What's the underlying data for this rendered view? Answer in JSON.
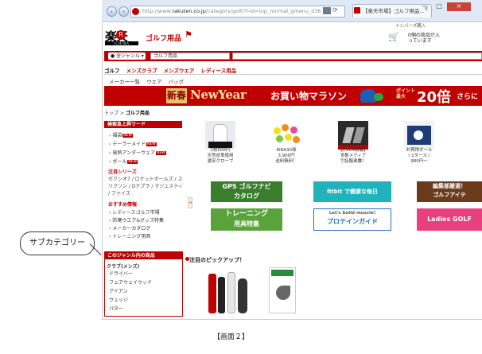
{
  "browser": {
    "back": "‹",
    "forward": "›",
    "url_prefix": "http://www.",
    "url_host": "rakuten.co.jp",
    "url_path": "/category/golf/?l-id=top_normal_gmenu_d36",
    "tab_title": "【楽天市場】ゴルフ用品...",
    "tab_close": "×",
    "minimize": "—",
    "maximize": "□",
    "close": "×"
  },
  "header": {
    "logo_text": "楽天",
    "logo_r": "R",
    "logo_sub": "ICHIBA",
    "genre_title": "ゴルフ用品",
    "topright_link": "ナンバーズ購入",
    "cart_text_line1": "0個の商品が入",
    "cart_text_line2": "っています"
  },
  "search": {
    "all_genre": "● 全ジャンル ▾",
    "genre_value": "ゴルフ用品"
  },
  "category_nav": {
    "items": [
      "ゴルフ",
      "メンズクラブ",
      "メンズウエア",
      "レディース用品"
    ]
  },
  "sub_nav": {
    "items": [
      "メーカー一覧",
      "ウエア",
      "バッグ"
    ]
  },
  "banner": {
    "new_kanji": "新春",
    "new_year": "NewYear",
    "marathon": "お買い物マラソン",
    "point_line1": "ポイント",
    "point_line2": "最大",
    "multiplier": "20倍",
    "more": "さらに"
  },
  "breadcrumb": {
    "top": "トップ >",
    "current": "ゴルフ用品"
  },
  "sidebar": {
    "rising_title": "検索急上昇ワード",
    "rising_items": [
      {
        "label": "福袋",
        "new": "NEW"
      },
      {
        "label": "テーラーメイド",
        "new": "NEW"
      },
      {
        "label": "発熱アンダーウェア",
        "new": "NEW"
      },
      {
        "label": "ボール",
        "new": "NEW"
      }
    ],
    "new_label": "NEW",
    "series_title": "注目シリーズ",
    "series_text": "ゼクシオ7 / ロケットボールズ / スリクソン / Dナブラ / マジェスティ / ファイズ",
    "recommend_title": "おすすめ情報",
    "recommend_items": [
      "レディースゴルフ市場",
      "防寒ウエア&グッズ特集",
      "メーカーカタログ",
      "トレーニング用具"
    ],
    "genre_box_title": "このジャンル内の商品",
    "club_label": "クラブ(メンズ)",
    "club_items": [
      "ドライバー",
      "フェアウェイウッド",
      "アイアン",
      "ウェッジ",
      "パター"
    ]
  },
  "products": [
    {
      "caption_line1": "1枚500円",
      "caption_line2": "天然皮革使用",
      "caption_line3": "激安グローブ"
    },
    {
      "caption_line1": "KIRA30球",
      "caption_line2": "3,900円",
      "caption_line3": "送料無料！"
    },
    {
      "caption_line1": "【EVEN掲載】",
      "caption_line2": "多数メディア",
      "caption_line3": "で話題沸騰！"
    },
    {
      "caption_line1": "お買得ボール",
      "caption_line2": "☆1ダース☆",
      "caption_line3": "980円〜"
    }
  ],
  "promos": {
    "gps_line1": "GPS ゴルフナビ",
    "gps_line2": "カタログ",
    "fitbit_line1": "fitbit で健康な毎日",
    "training_line1": "トレーニング",
    "training_line2": "用具特集",
    "protein_line1": "Let's build muscle!",
    "protein_line2": "プロテインガイド",
    "edit_line1": "編集部厳選！",
    "edit_line2": "ゴルフアイテ",
    "ladies_line1": "Ladies GOLF"
  },
  "pickup": {
    "title": "注目のピックアップ！"
  },
  "annotation": {
    "label": "サブカテゴリー"
  },
  "caption": {
    "text": "【画面２】"
  },
  "colors": {
    "rakuten_red": "#bf0000",
    "banner_red": "#c00000"
  }
}
